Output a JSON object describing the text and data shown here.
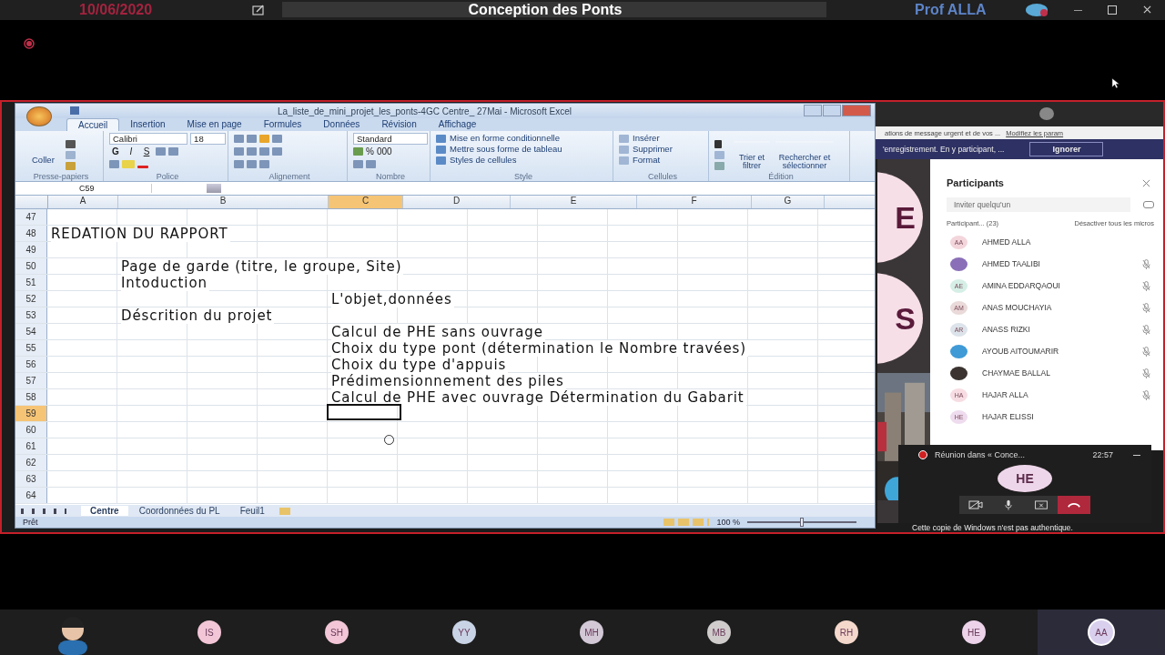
{
  "meeting_bar": {
    "date": "10/06/2020",
    "title": "Conception des Ponts",
    "presenter": "Prof ALLA",
    "recording": true
  },
  "excel": {
    "title": "La_liste_de_mini_projet_les_ponts-4GC Centre_ 27Mai - Microsoft Excel",
    "ribbon_tabs": [
      {
        "label": "Accueil",
        "selected": true
      },
      {
        "label": "Insertion",
        "selected": false
      },
      {
        "label": "Mise en page",
        "selected": false
      },
      {
        "label": "Formules",
        "selected": false
      },
      {
        "label": "Données",
        "selected": false
      },
      {
        "label": "Révision",
        "selected": false
      },
      {
        "label": "Affichage",
        "selected": false
      }
    ],
    "clipboard": {
      "paste": "Coller",
      "group": "Presse-papiers"
    },
    "font": {
      "name": "Calibri",
      "size": "18",
      "bold": "G",
      "italic": "I",
      "underline": "S",
      "group": "Police"
    },
    "alignment": {
      "group": "Alignement"
    },
    "number": {
      "format": "Standard",
      "percent": "%",
      "thousands": "000",
      "group": "Nombre"
    },
    "style": {
      "items": [
        "Mise en forme conditionnelle",
        "Mettre sous forme de tableau",
        "Styles de cellules"
      ],
      "group": "Style"
    },
    "cells": {
      "items": [
        "Insérer",
        "Supprimer",
        "Format"
      ],
      "group": "Cellules"
    },
    "editing": {
      "sort": "Trier et filtrer",
      "find": "Rechercher et sélectionner",
      "group": "Édition"
    },
    "name_box": "C59",
    "columns": [
      {
        "label": "A",
        "selected": false
      },
      {
        "label": "B",
        "selected": false
      },
      {
        "label": "C",
        "selected": true
      },
      {
        "label": "D",
        "selected": false
      },
      {
        "label": "E",
        "selected": false
      },
      {
        "label": "F",
        "selected": false
      },
      {
        "label": "G",
        "selected": false
      }
    ],
    "rows": [
      {
        "number": "47",
        "selected": false,
        "cells": []
      },
      {
        "number": "48",
        "selected": false,
        "cells": [
          {
            "kind": "section",
            "text": "REDATION DU RAPPORT"
          }
        ]
      },
      {
        "number": "49",
        "selected": false,
        "cells": []
      },
      {
        "number": "50",
        "selected": false,
        "cells": [
          {
            "kind": "topic",
            "text": "Page de garde (titre, le groupe, Site)"
          }
        ]
      },
      {
        "number": "51",
        "selected": false,
        "cells": [
          {
            "kind": "topic",
            "text": "Intoduction"
          }
        ]
      },
      {
        "number": "52",
        "selected": false,
        "cells": [
          {
            "kind": "task",
            "text": "L'objet,données"
          }
        ]
      },
      {
        "number": "53",
        "selected": false,
        "cells": [
          {
            "kind": "topic",
            "text": "Déscrition du projet"
          }
        ]
      },
      {
        "number": "54",
        "selected": false,
        "cells": [
          {
            "kind": "task",
            "text": "Calcul de PHE sans ouvrage"
          }
        ]
      },
      {
        "number": "55",
        "selected": false,
        "cells": [
          {
            "kind": "task",
            "text": "Choix du type pont (détermination le Nombre  travées)"
          }
        ]
      },
      {
        "number": "56",
        "selected": false,
        "cells": [
          {
            "kind": "task",
            "text": "Choix du type d'appuis"
          }
        ]
      },
      {
        "number": "57",
        "selected": false,
        "cells": [
          {
            "kind": "task",
            "text": "Prédimensionnement des piles"
          }
        ]
      },
      {
        "number": "58",
        "selected": false,
        "cells": [
          {
            "kind": "task",
            "text": "Calcul de PHE avec ouvrage  Détermination du Gabarit"
          }
        ]
      },
      {
        "number": "59",
        "selected": true,
        "cells": []
      },
      {
        "number": "60",
        "selected": false,
        "cells": []
      },
      {
        "number": "61",
        "selected": false,
        "cells": []
      },
      {
        "number": "62",
        "selected": false,
        "cells": []
      },
      {
        "number": "63",
        "selected": false,
        "cells": []
      },
      {
        "number": "64",
        "selected": false,
        "cells": []
      }
    ],
    "sheet_tabs": [
      {
        "label": "Centre",
        "selected": true
      },
      {
        "label": "Coordonnées du PL",
        "selected": false
      },
      {
        "label": "Feuil1",
        "selected": false
      }
    ],
    "status": "Prêt",
    "zoom": "100 %",
    "zoom_slider": {
      "level": 0.5
    }
  },
  "teams": {
    "notice": "ations de message urgent et de vos ...",
    "notice_link": "Modifiez les param",
    "recording_notice": "'enregistrement. En y participant, ...",
    "dismiss": "Ignorer",
    "slide_letters": [
      "E",
      "S"
    ],
    "panel_title": "Participants",
    "invite_placeholder": "Inviter quelqu'un",
    "section": "Participant...  (23)",
    "mute_all": "Désactiver tous les micros",
    "participants": [
      {
        "initials": "AA",
        "name": "AHMED ALLA",
        "kind": "initials",
        "color": "#f3d6dc",
        "muted": false
      },
      {
        "name": "AHMED TAALIBI",
        "color": "#8a6fb8",
        "muted": true
      },
      {
        "initials": "AE",
        "name": "AMINA EDDARQAOUI",
        "kind": "initials",
        "color": "#d6efe6",
        "muted": true
      },
      {
        "initials": "AM",
        "name": "ANAS MOUCHAYIA",
        "kind": "initials",
        "color": "#ead9d9",
        "muted": true
      },
      {
        "initials": "AR",
        "name": "ANASS RIZKI",
        "kind": "initials",
        "color": "#dde3ea",
        "muted": true
      },
      {
        "name": "AYOUB AITOUMARIR",
        "color": "#3f9ad6",
        "muted": true
      },
      {
        "name": "CHAYMAE BALLAL",
        "color": "#3a3330",
        "muted": true
      },
      {
        "initials": "HA",
        "name": "HAJAR ALLA",
        "kind": "initials",
        "color": "#f7dde3",
        "muted": true
      },
      {
        "initials": "HE",
        "name": "HAJAR ELISSI",
        "kind": "initials",
        "color": "#eedcee",
        "muted": false
      }
    ],
    "call": {
      "title": "Réunion dans « Conce...",
      "time": "22:57",
      "initials": "HE"
    },
    "windows_notice": "Cette copie de Windows n'est pas authentique."
  },
  "tiles": [
    {
      "kind": "figure",
      "color": "#2a6fb0",
      "selected": false
    },
    {
      "kind": "initials",
      "initials": "IS",
      "color": "#f2c6d6",
      "selected": false
    },
    {
      "kind": "initials",
      "initials": "SH",
      "color": "#f2c6d6",
      "selected": false
    },
    {
      "kind": "initials",
      "initials": "YY",
      "color": "#c9d3e6",
      "selected": false
    },
    {
      "kind": "initials",
      "initials": "MH",
      "color": "#d2c8d6",
      "selected": false
    },
    {
      "kind": "initials",
      "initials": "MB",
      "color": "#d0cccc",
      "selected": false
    },
    {
      "kind": "initials",
      "initials": "RH",
      "color": "#f5d8cc",
      "selected": false
    },
    {
      "kind": "initials",
      "initials": "HE",
      "color": "#ecd3ea",
      "selected": false
    },
    {
      "kind": "initials",
      "initials": "AA",
      "color": "#d9d0ee",
      "selected": true
    }
  ]
}
